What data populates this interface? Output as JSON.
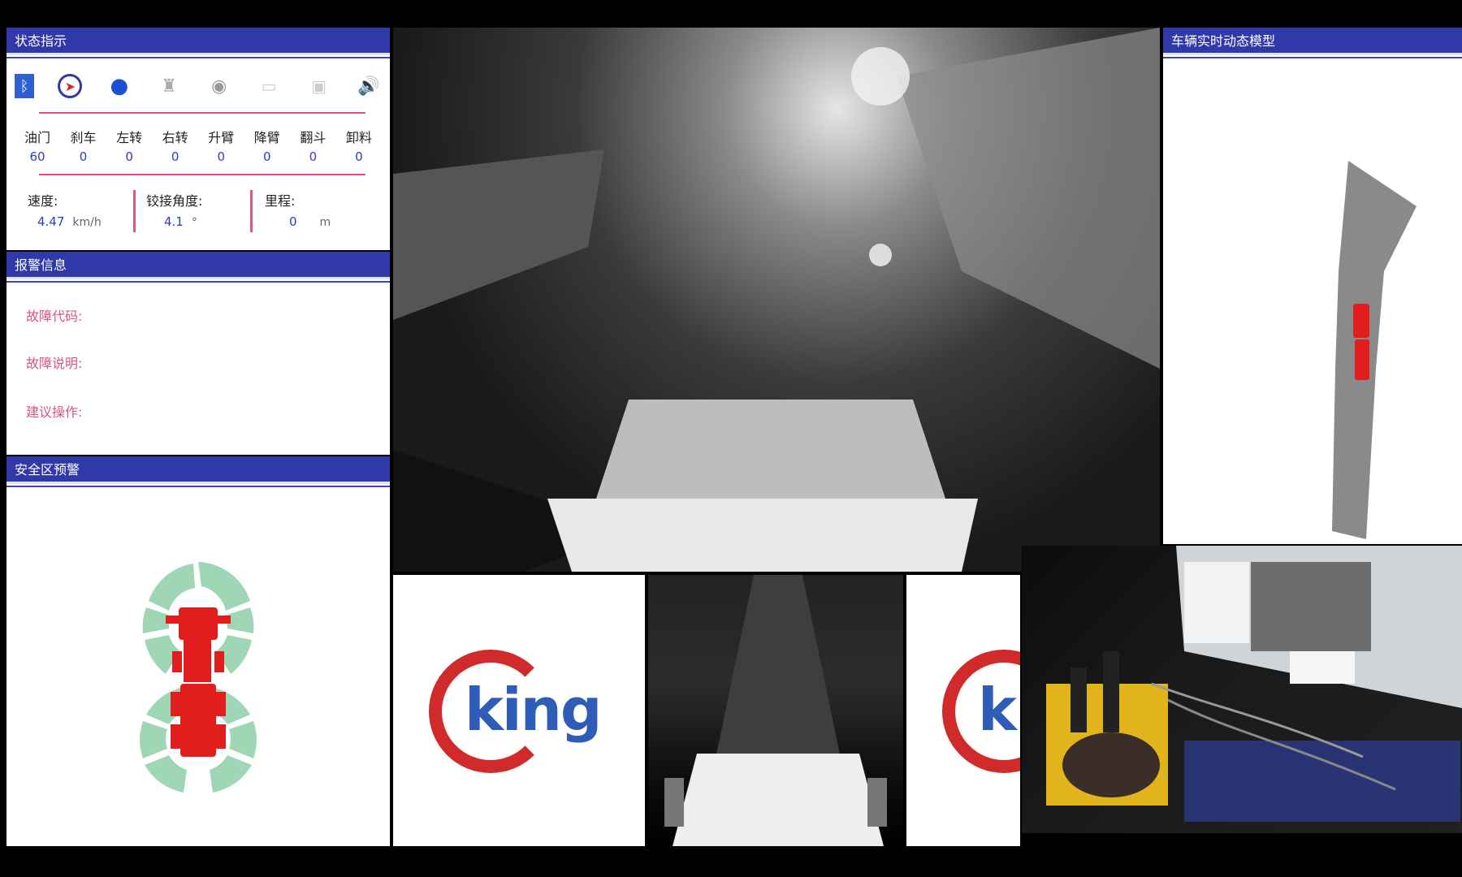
{
  "status_panel": {
    "title": "状态指示",
    "icons": [
      "bluetooth-icon",
      "compass-icon",
      "light-icon",
      "horn-icon",
      "camera-icon",
      "vibration-icon",
      "radio-icon",
      "speaker-icon"
    ],
    "controls": [
      {
        "label": "油门",
        "value": "60"
      },
      {
        "label": "刹车",
        "value": "0"
      },
      {
        "label": "左转",
        "value": "0"
      },
      {
        "label": "右转",
        "value": "0"
      },
      {
        "label": "升臂",
        "value": "0"
      },
      {
        "label": "降臂",
        "value": "0"
      },
      {
        "label": "翻斗",
        "value": "0"
      },
      {
        "label": "卸料",
        "value": "0"
      }
    ],
    "speed": {
      "label": "速度:",
      "value": "4.47",
      "unit": "km/h"
    },
    "angle": {
      "label": "铰接角度:",
      "value": "4.1",
      "unit": "°"
    },
    "distance": {
      "label": "里程:",
      "value": "0",
      "unit": "m"
    }
  },
  "alarm_panel": {
    "title": "报警信息",
    "fault_code": "故障代码:",
    "fault_desc": "故障说明:",
    "suggest": "建议操作:"
  },
  "safety_panel": {
    "title": "安全区预警"
  },
  "model_panel": {
    "title": "车辆实时动态模型"
  },
  "logo": {
    "text": "king"
  },
  "colors": {
    "header_blue": "#2f3aa8",
    "accent_pink": "#d9577b",
    "value_blue": "#2b3fc0",
    "vehicle_red": "#e11d1d",
    "zone_green": "#9ed6b6"
  }
}
